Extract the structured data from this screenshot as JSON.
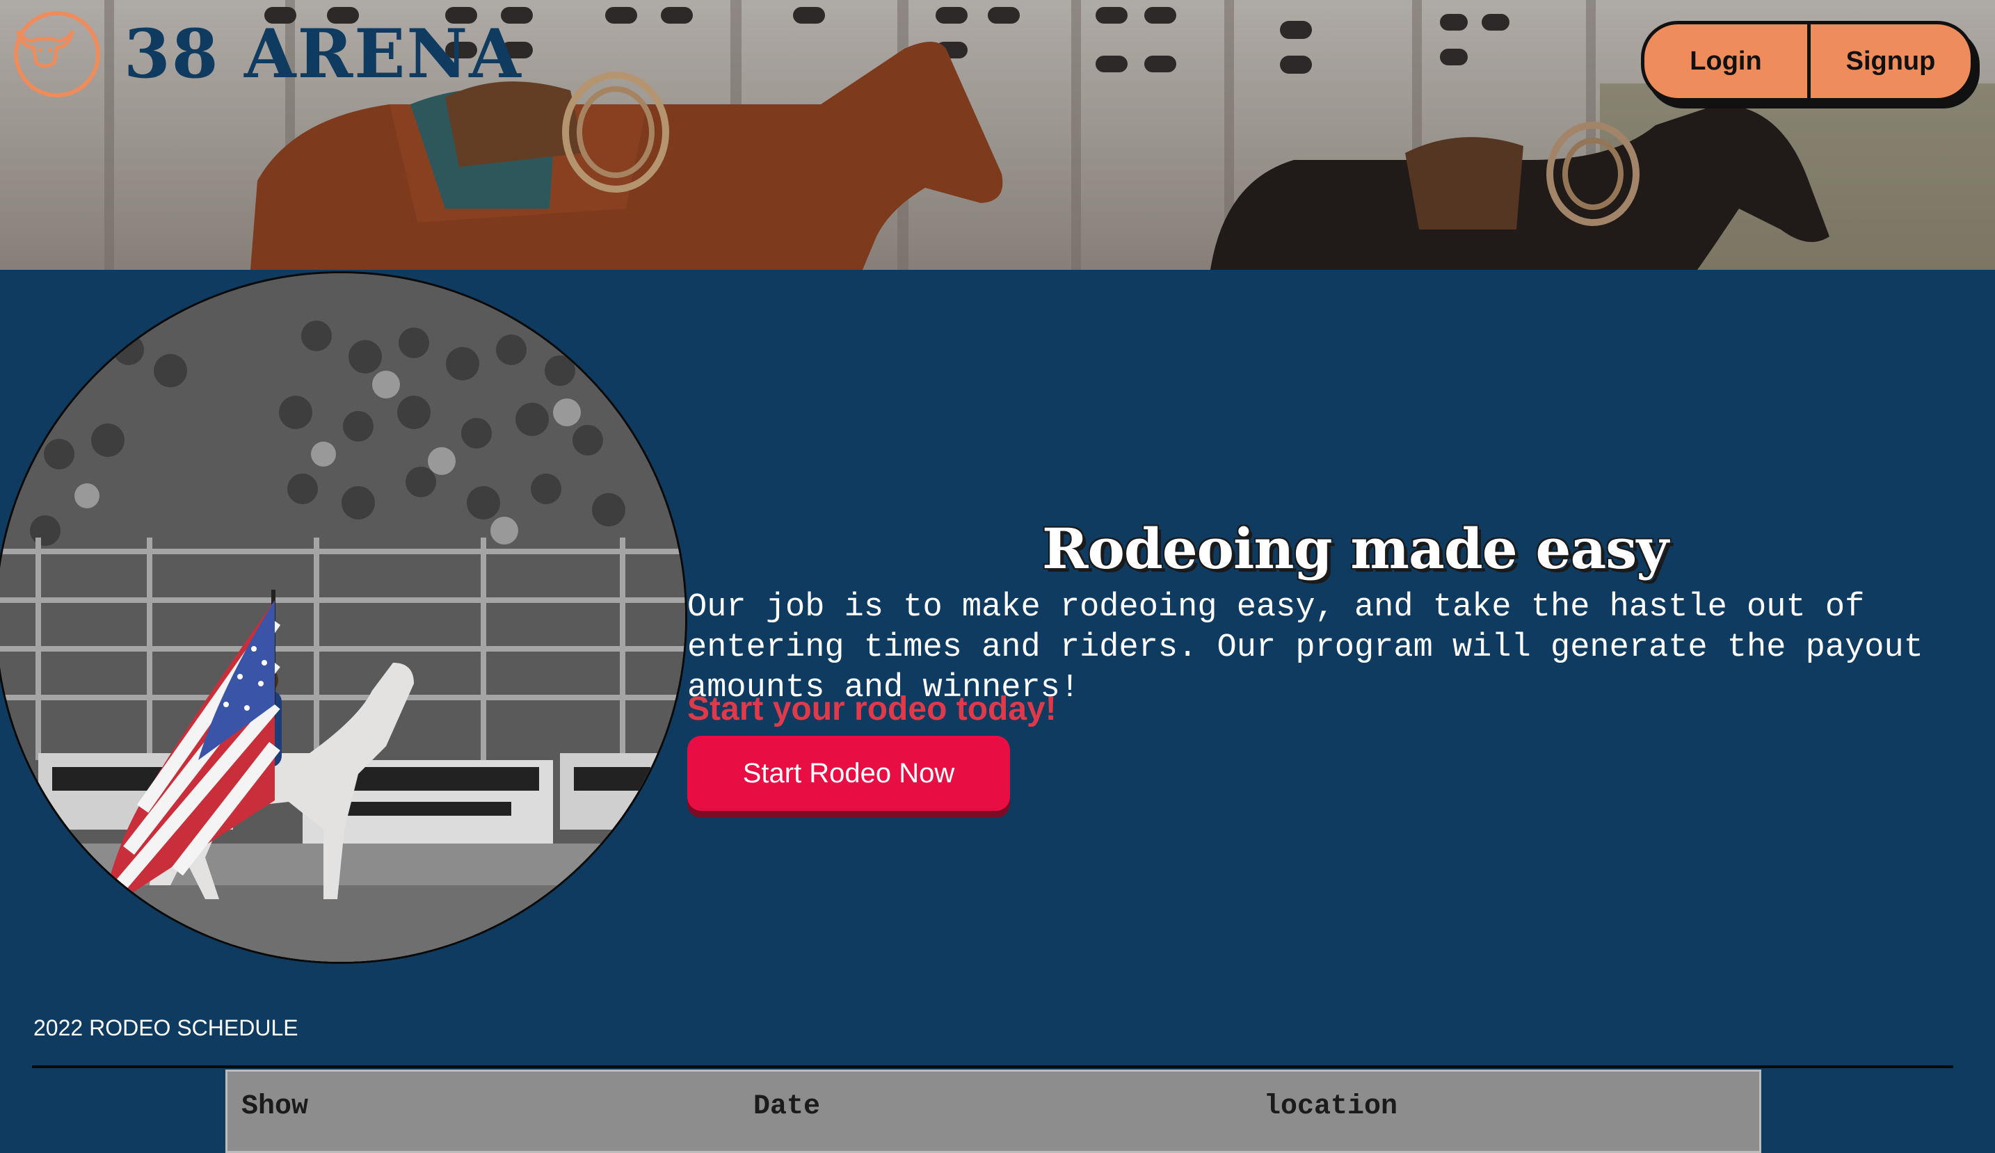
{
  "header": {
    "logo_text": "38 ARENA",
    "login_label": "Login",
    "signup_label": "Signup"
  },
  "hero": {
    "title": "Rodeoing made easy",
    "body": "Our job is to make rodeoing easy, and take the hastle out of entering times and riders. Our program will generate the payout amounts and winners!",
    "cta_text": "Start your rodeo today!",
    "button_label": "Start Rodeo Now"
  },
  "schedule": {
    "title": "2022 RODEO SCHEDULE",
    "columns": [
      "Show",
      "Date",
      "location"
    ]
  },
  "colors": {
    "page_background": "#0f3b60",
    "accent_orange": "#ee8c5b",
    "cta_red": "#e80e43",
    "cta_text_red": "#e0394a"
  },
  "icons": {
    "logo": "bull-skull-icon"
  }
}
